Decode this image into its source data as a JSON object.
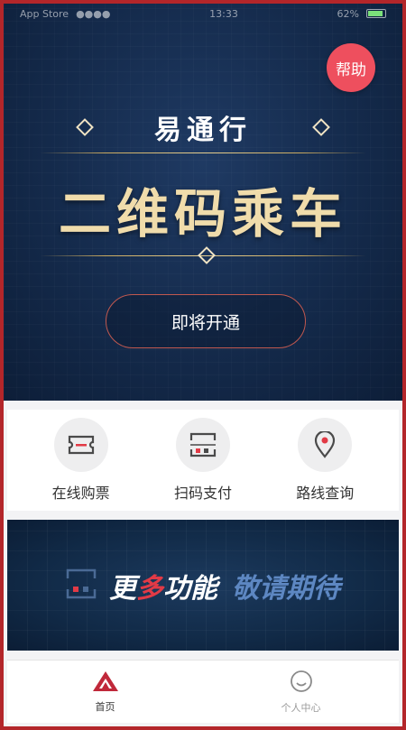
{
  "status_bar": {
    "carrier": "App Store",
    "time": "13:33",
    "battery": "62%"
  },
  "hero": {
    "help_label": "帮助",
    "brand": "易通行",
    "title": "二维码乘车",
    "open_button": "即将开通"
  },
  "actions": [
    {
      "label": "在线购票",
      "icon": "ticket-icon"
    },
    {
      "label": "扫码支付",
      "icon": "scan-icon"
    },
    {
      "label": "路线查询",
      "icon": "location-pin-icon"
    }
  ],
  "banner": {
    "part1": "更多功能",
    "part2": "敬请期待"
  },
  "bottom_nav": [
    {
      "label": "首页",
      "icon": "home-logo-icon",
      "active": true
    },
    {
      "label": "个人中心",
      "icon": "smiley-icon",
      "active": false
    }
  ],
  "colors": {
    "accent_red": "#e23a46",
    "help_pink": "#ee4f5e",
    "hero_navy": "#142a4b",
    "gold": "#f0dcab"
  }
}
